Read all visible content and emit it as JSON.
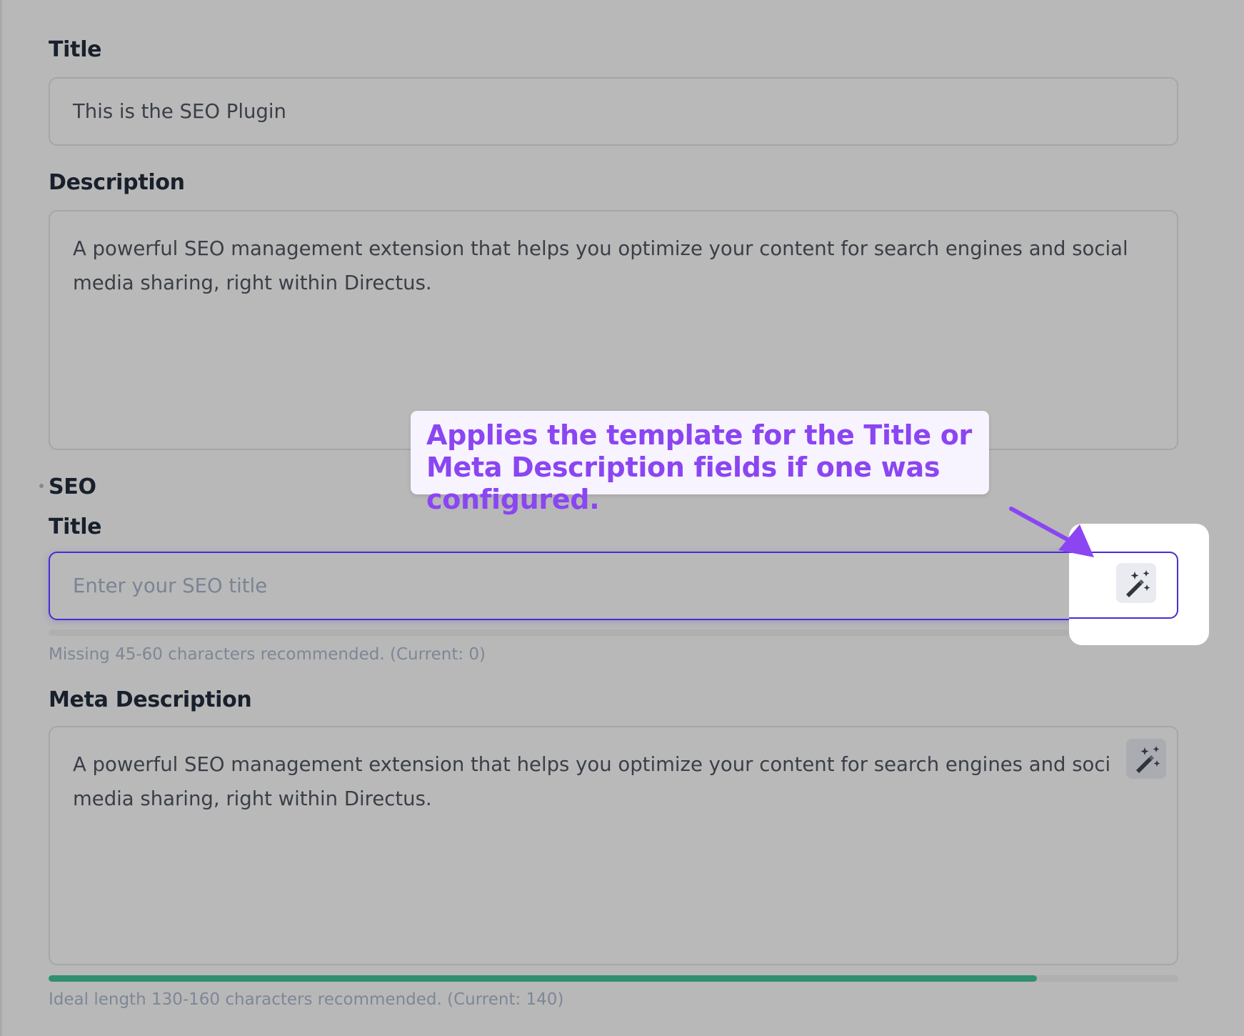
{
  "form": {
    "title_label": "Title",
    "title_value": "This is the SEO Plugin",
    "description_label": "Description",
    "description_value": "A powerful SEO management extension that helps you optimize your content for search engines and social media sharing, right within Directus.",
    "seo_group_label": "SEO",
    "seo_title_label": "Title",
    "seo_title_placeholder": "Enter your SEO title",
    "seo_title_hint": "Missing 45-60 characters recommended. (Current: 0)",
    "seo_title_progress": 0,
    "meta_description_label": "Meta Description",
    "meta_description_value": "A powerful SEO management extension that helps you optimize your content for search engines and soci media sharing, right within Directus.",
    "meta_description_hint": "Ideal length 130-160 characters recommended. (Current: 140)",
    "meta_description_progress": 0.875
  },
  "callout": {
    "text": "Applies the template for the Title or Meta Description fields if one was configured."
  },
  "icons": {
    "template_button": "magic-wand-sparkles-icon"
  },
  "colors": {
    "callout_text": "#8b45f2",
    "arrow": "#8b45f2",
    "focus_border": "#4a2ad6",
    "progress_fill": "#2f8f6e"
  }
}
